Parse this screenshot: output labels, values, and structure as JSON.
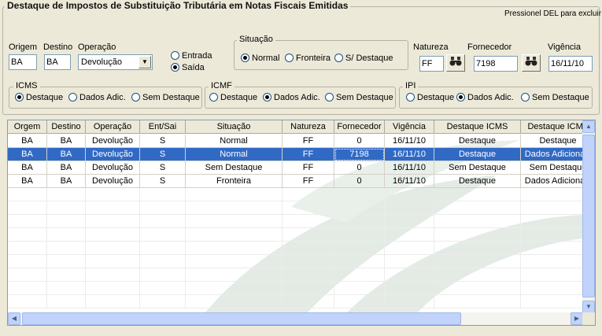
{
  "title": "Destaque de Impostos de Substituição Tributária em Notas Fiscais Emitidas",
  "hint": "Pressionel DEL para excluir",
  "fields": {
    "origem_label": "Origem",
    "origem_value": "BA",
    "destino_label": "Destino",
    "destino_value": "BA",
    "operacao_label": "Operação",
    "operacao_value": "Devolução",
    "natureza_label": "Natureza",
    "natureza_value": "FF",
    "fornecedor_label": "Fornecedor",
    "fornecedor_value": "7198",
    "vigencia_label": "Vigência",
    "vigencia_value": "16/11/10"
  },
  "entsai": {
    "entrada": "Entrada",
    "saida": "Saída",
    "selected": "saida"
  },
  "situacao": {
    "legend": "Situação",
    "normal": "Normal",
    "fronteira": "Fronteira",
    "sem_destaque": "S/ Destaque",
    "selected": "normal"
  },
  "icms": {
    "legend": "ICMS",
    "destaque": "Destaque",
    "dados_adic": "Dados Adic.",
    "sem_destaque": "Sem Destaque",
    "selected": "destaque"
  },
  "icmf": {
    "legend": "ICMF",
    "destaque": "Destaque",
    "dados_adic": "Dados Adic.",
    "sem_destaque": "Sem Destaque",
    "selected": "dados_adic"
  },
  "ipi": {
    "legend": "IPI",
    "destaque": "Destaque",
    "dados_adic": "Dados Adic.",
    "sem_destaque": "Sem Destaque",
    "selected": "dados_adic"
  },
  "icons": {
    "search": "binoculars-icon",
    "dropdown": "chevron-down-icon"
  },
  "colors": {
    "selection": "#316ac5",
    "background": "#ece9d8"
  },
  "table": {
    "columns": [
      "Orgem",
      "Destino",
      "Operação",
      "Ent/Sai",
      "Situação",
      "Natureza",
      "Fornecedor",
      "Vigência",
      "Destaque ICMS",
      "Destaque ICMF"
    ],
    "rows": [
      [
        "BA",
        "BA",
        "Devolução",
        "S",
        "Normal",
        "FF",
        "0",
        "16/11/10",
        "Destaque",
        "Destaque"
      ],
      [
        "BA",
        "BA",
        "Devolução",
        "S",
        "Normal",
        "FF",
        "7198",
        "16/11/10",
        "Destaque",
        "Dados Adicionais"
      ],
      [
        "BA",
        "BA",
        "Devolução",
        "S",
        "Sem Destaque",
        "FF",
        "0",
        "16/11/10",
        "Sem Destaque",
        "Sem Destaque"
      ],
      [
        "BA",
        "BA",
        "Devolução",
        "S",
        "Fronteira",
        "FF",
        "0",
        "16/11/10",
        "Destaque",
        "Dados Adicionais"
      ]
    ],
    "selected_row": 1
  }
}
